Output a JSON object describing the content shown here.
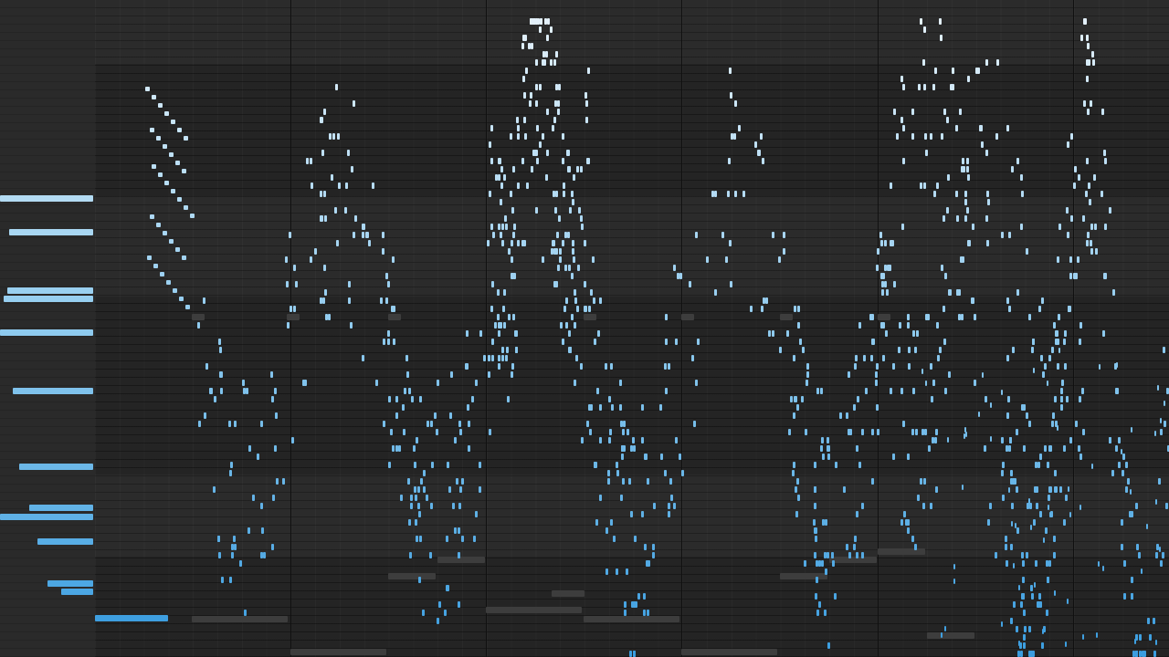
{
  "app": {
    "view": "piano-roll-visualizer"
  },
  "colors": {
    "background": "#232323",
    "keyboard": "#2a2a2a",
    "bar_line": "#101010",
    "hold_note": "#3d3d3d",
    "note_high": "#e8f3fb",
    "note_mid": "#8fcbef",
    "note_low": "#3a9de0"
  },
  "keyboard": {
    "pressed_keys": [
      {
        "key": "C6",
        "state": "pressed"
      },
      {
        "key": "A5",
        "state": "pressed"
      },
      {
        "key": "E5",
        "state": "pressed"
      },
      {
        "key": "D5",
        "state": "pressed"
      },
      {
        "key": "B4",
        "state": "pressed"
      },
      {
        "key": "G4",
        "state": "pressed"
      },
      {
        "key": "D4",
        "state": "pressed"
      },
      {
        "key": "B3",
        "state": "pressed"
      },
      {
        "key": "A3",
        "state": "pressed"
      },
      {
        "key": "G3",
        "state": "pressed"
      },
      {
        "key": "D3",
        "state": "pressed"
      },
      {
        "key": "C3",
        "state": "pressed"
      }
    ]
  }
}
